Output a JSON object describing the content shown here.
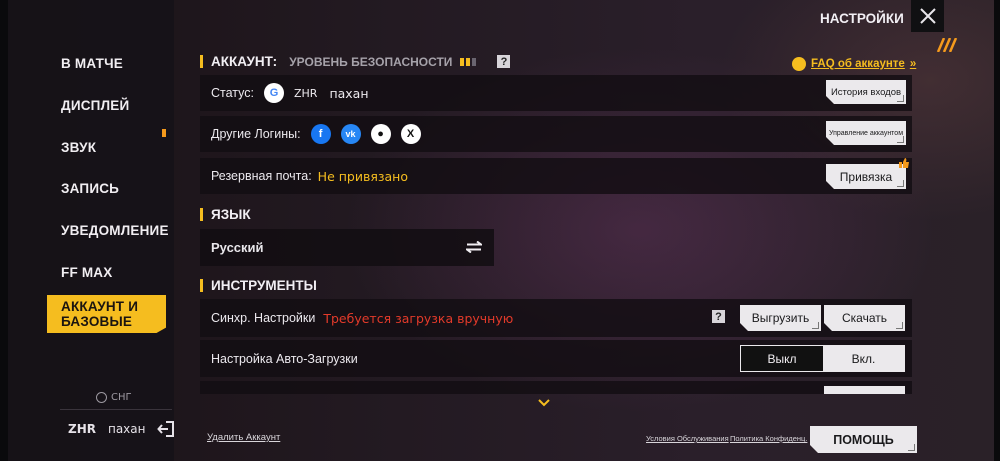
{
  "header": {
    "title": "НАСТРОЙКИ"
  },
  "sidebar": {
    "items": [
      {
        "label": "В МАТЧЕ"
      },
      {
        "label": "ДИСПЛЕЙ"
      },
      {
        "label": "ЗВУК"
      },
      {
        "label": "ЗАПИСЬ"
      },
      {
        "label": "УВЕДОМЛЕНИЕ"
      },
      {
        "label": "FF MAX"
      },
      {
        "label": "АККАУНТ И БАЗОВЫЕ"
      }
    ],
    "active_index": 6,
    "region": "СНГ",
    "user": {
      "tag": "ZHR",
      "name": "пахан"
    }
  },
  "account": {
    "section_title": "АККАУНТ:",
    "security_label": "УРОВЕНЬ БЕЗОПАСНОСТИ",
    "security_level": 2,
    "security_max": 3,
    "faq_link": "FAQ об аккаунте",
    "status_label": "Статус:",
    "status_tag": "ZHR",
    "status_name": "пахан",
    "history_button": "История входов",
    "other_logins_label": "Другие Логины:",
    "manage_button": "Управление аккаунтом",
    "backup_email_label": "Резервная почта:",
    "backup_email_value": "Не привязано",
    "bind_button": "Привязка"
  },
  "language": {
    "section_title": "ЯЗЫК",
    "current": "Русский"
  },
  "tools": {
    "section_title": "ИНСТРУМЕНТЫ",
    "sync_label": "Синхр. Настройки",
    "sync_status": "Требуется загрузка вручную",
    "upload_button": "Выгрузить",
    "download_button": "Скачать",
    "autoload_label": "Настройка Авто-Загрузки",
    "toggle_off": "Выкл",
    "toggle_on": "Вкл."
  },
  "footer": {
    "delete_account": "Удалить Аккаунт",
    "terms": "Условия Обслуживания",
    "privacy": "Политика Конфиденц.",
    "help_button": "ПОМОЩЬ"
  },
  "colors": {
    "accent": "#f5bd1f",
    "warning": "#e33a2a"
  }
}
